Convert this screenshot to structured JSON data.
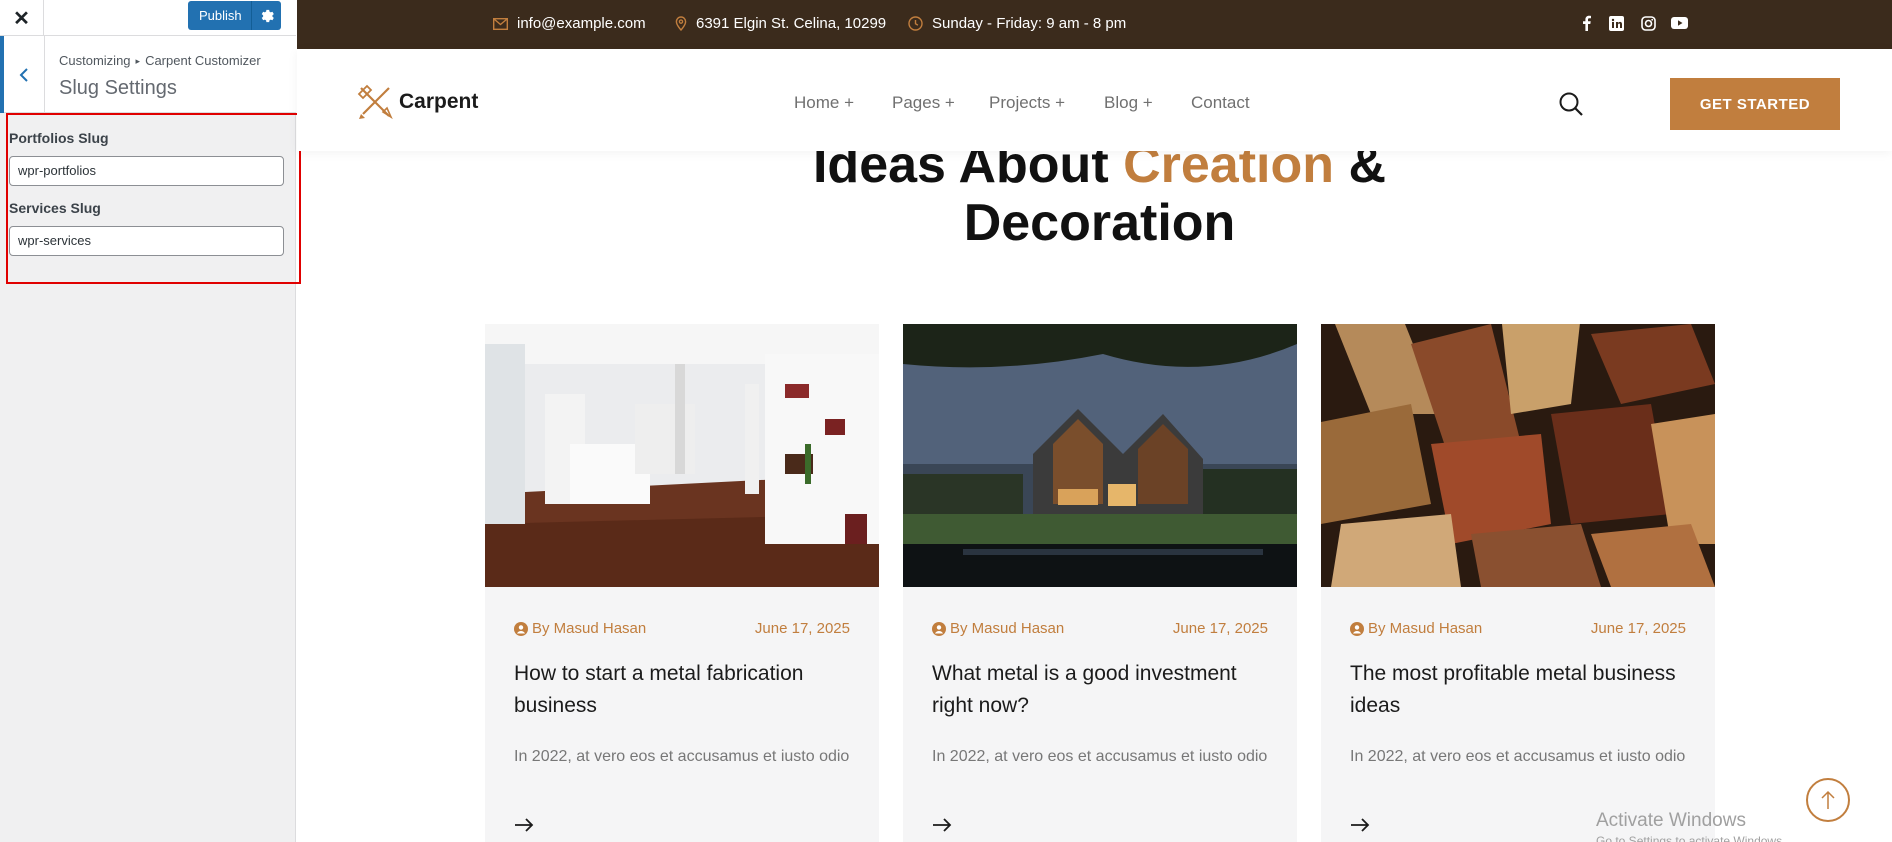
{
  "sidebar": {
    "close_icon": "close-icon",
    "publish_label": "Publish",
    "crumb_root": "Customizing",
    "crumb_current": "Carpent Customizer",
    "section_title": "Slug Settings",
    "fields": [
      {
        "label": "Portfolios Slug",
        "value": "wpr-portfolios"
      },
      {
        "label": "Services Slug",
        "value": "wpr-services"
      }
    ]
  },
  "topbar": {
    "email": "info@example.com",
    "address": "6391 Elgin St. Celina, 10299",
    "hours": "Sunday - Friday: 9 am - 8 pm",
    "socials": [
      "facebook-icon",
      "linkedin-icon",
      "instagram-icon",
      "youtube-icon"
    ]
  },
  "header": {
    "logo_text": "Carpent",
    "nav": [
      "Home +",
      "Pages +",
      "Projects +",
      "Blog +",
      "Contact"
    ],
    "cta_label": "GET STARTED"
  },
  "heading": {
    "part1": "Ideas About ",
    "accent": "Creation",
    "part2": " &",
    "line2": "Decoration"
  },
  "posts": [
    {
      "author": "By Masud Hasan",
      "date": "June 17, 2025",
      "title": "How to start a metal fabrication business",
      "excerpt": "In 2022, at vero eos et accusamus et iusto odio"
    },
    {
      "author": "By Masud Hasan",
      "date": "June 17, 2025",
      "title": "What metal is a good investment right now?",
      "excerpt": "In 2022, at vero eos et accusamus et iusto odio"
    },
    {
      "author": "By Masud Hasan",
      "date": "June 17, 2025",
      "title": "The most profitable metal business ideas",
      "excerpt": "In 2022, at vero eos et accusamus et iusto odio"
    }
  ],
  "watermark": {
    "line1": "Activate Windows",
    "line2": "Go to Settings to activate Windows."
  },
  "colors": {
    "accent": "#c17e3e",
    "topbar": "#3b2b1c",
    "wp_blue": "#2271b1",
    "highlight": "#e00000"
  }
}
